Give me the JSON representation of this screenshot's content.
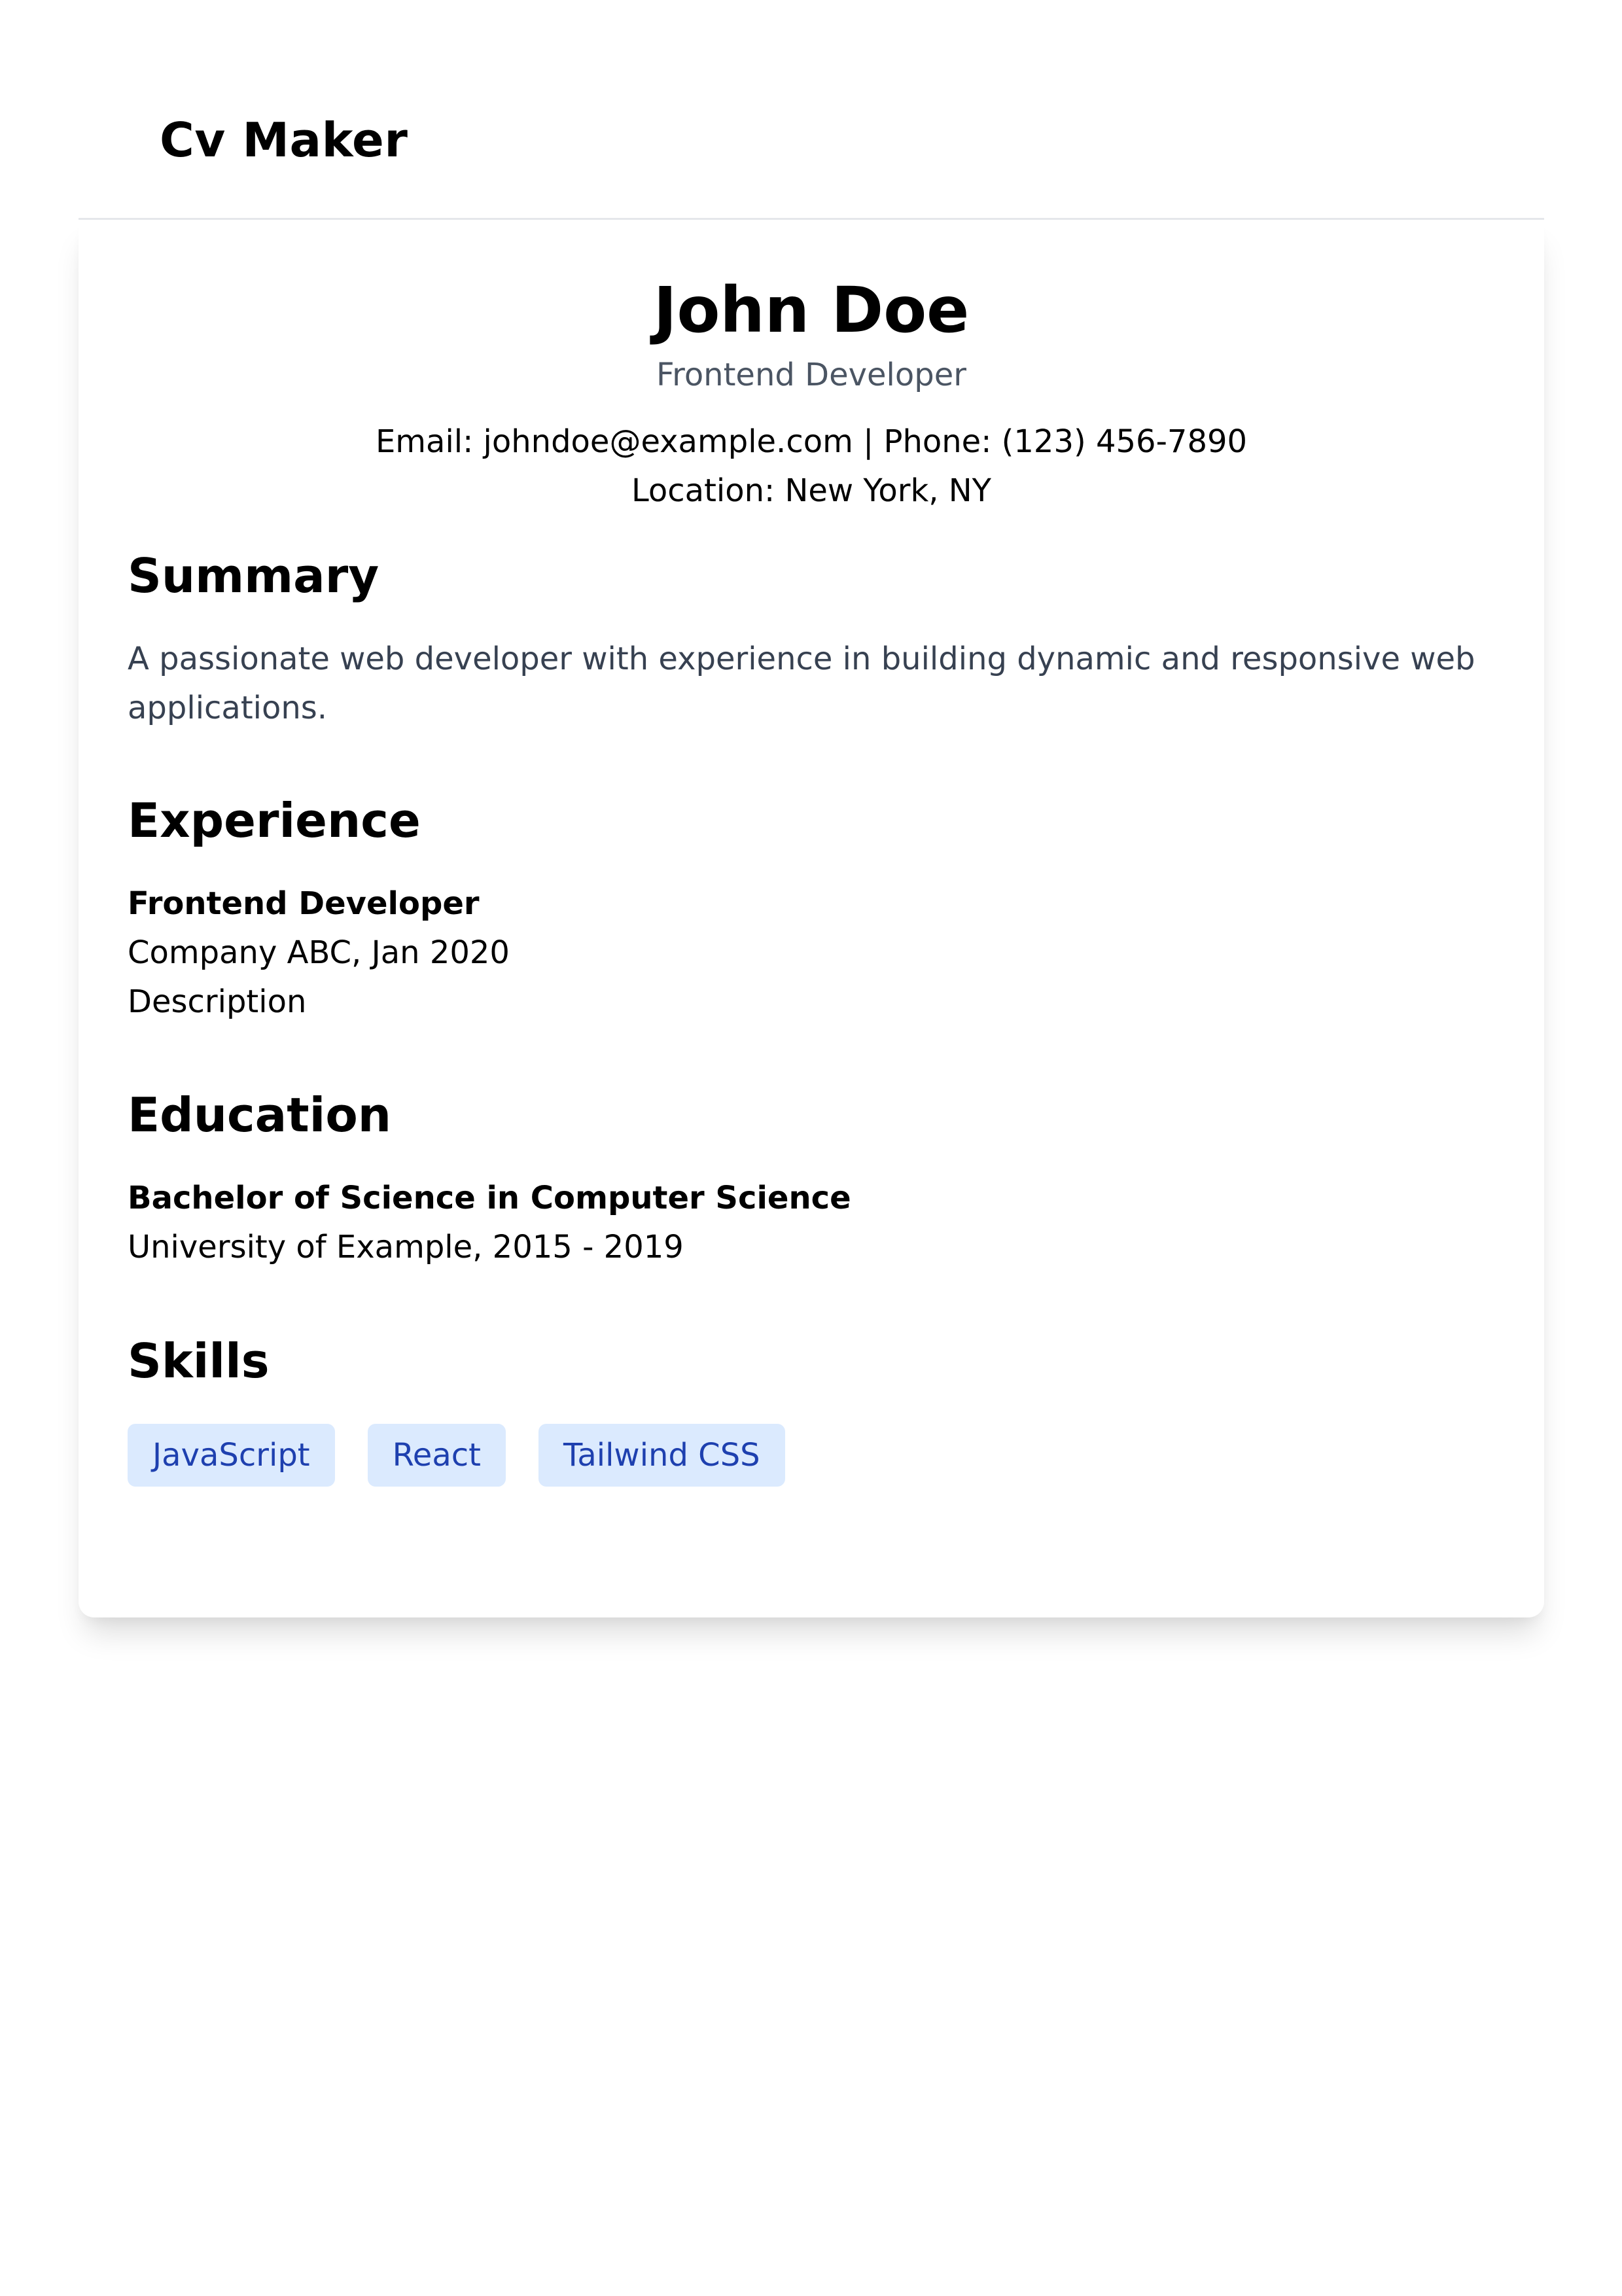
{
  "app": {
    "title": "Cv Maker"
  },
  "cv": {
    "name": "John Doe",
    "title": "Frontend Developer",
    "contact_line": "Email: johndoe@example.com | Phone: (123) 456-7890",
    "location_line": "Location: New York, NY",
    "summary": {
      "heading": "Summary",
      "text": "A passionate web developer with experience in building dynamic and responsive web applications."
    },
    "experience": {
      "heading": "Experience",
      "items": [
        {
          "role": "Frontend Developer",
          "company_date": "Company ABC, Jan 2020",
          "description": "Description"
        }
      ]
    },
    "education": {
      "heading": "Education",
      "items": [
        {
          "degree": "Bachelor of Science in Computer Science",
          "school_dates": "University of Example, 2015 - 2019"
        }
      ]
    },
    "skills": {
      "heading": "Skills",
      "items": [
        "JavaScript",
        "React",
        "Tailwind CSS"
      ]
    }
  },
  "colors": {
    "skill_tag_bg": "#dbeafe",
    "skill_tag_text": "#1e40af",
    "subtitle_text": "#4b5563",
    "body_text": "#374151",
    "divider": "#e5e7eb"
  }
}
